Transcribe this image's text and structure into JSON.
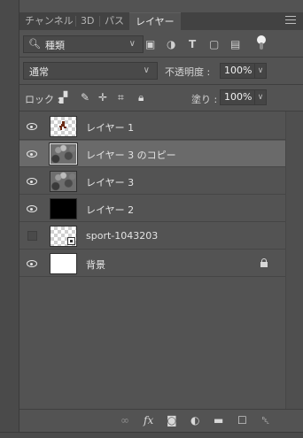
{
  "tabs": [
    {
      "label": "チャンネル",
      "active": false
    },
    {
      "label": "3D",
      "active": false
    },
    {
      "label": "パス",
      "active": false
    },
    {
      "label": "レイヤー",
      "active": true
    }
  ],
  "filter": {
    "kind_label": "種類",
    "search_icon": "search-icon"
  },
  "blend": {
    "mode": "通常",
    "opacity_label": "不透明度 :",
    "opacity_value": "100%"
  },
  "lock": {
    "label": "ロック :",
    "fill_label": "塗り :",
    "fill_value": "100%"
  },
  "layers": [
    {
      "name": "レイヤー 1",
      "visible": true,
      "thumb": "checker-runner",
      "selected": false,
      "locked": false
    },
    {
      "name": "レイヤー 3 のコピー",
      "visible": true,
      "thumb": "cloud",
      "selected": true,
      "locked": false
    },
    {
      "name": "レイヤー 3",
      "visible": true,
      "thumb": "cloud",
      "selected": false,
      "locked": false
    },
    {
      "name": "レイヤー 2",
      "visible": true,
      "thumb": "black",
      "selected": false,
      "locked": false
    },
    {
      "name": "sport-1043203",
      "visible": false,
      "thumb": "checker-smart",
      "selected": false,
      "locked": false
    },
    {
      "name": "背景",
      "visible": true,
      "thumb": "white",
      "selected": false,
      "locked": true
    }
  ],
  "bottom_tools": [
    "link-layers-icon",
    "fx-icon",
    "add-mask-icon",
    "adjustment-layer-icon",
    "new-group-icon",
    "new-layer-icon",
    "delete-layer-icon"
  ],
  "colors": {
    "panel": "#535353",
    "selected_row": "#6a6a6a",
    "tab_bar": "#424242"
  }
}
